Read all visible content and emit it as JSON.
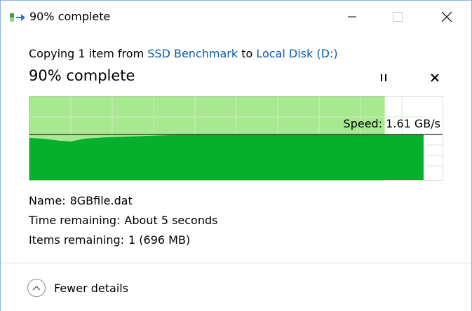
{
  "window": {
    "title": "90% complete",
    "controls": {
      "minimize": "minimize",
      "maximize": "maximize",
      "close": "close"
    }
  },
  "copy": {
    "prefix": "Copying 1 item from",
    "source": "SSD Benchmark",
    "connector": "to",
    "destination": "Local Disk (D:)"
  },
  "progress": {
    "heading": "90% complete",
    "percent": 90,
    "speed_label": "Speed: 1.61 GB/s"
  },
  "details": {
    "name_label": "Name:",
    "name_value": "8GBfile.dat",
    "time_label": "Time remaining:",
    "time_value": "About 5 seconds",
    "items_label": "Items remaining:",
    "items_value": "1 (696 MB)"
  },
  "footer": {
    "fewer_details": "Fewer details"
  },
  "colors": {
    "graph_fill_light": "#a8e890",
    "graph_fill_dark": "#06b02c",
    "link": "#0a5ca6"
  }
}
